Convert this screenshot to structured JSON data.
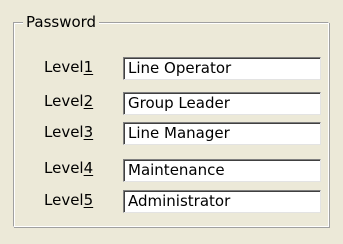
{
  "group": {
    "title": "Password"
  },
  "levels": [
    {
      "label": "Level",
      "number": "1",
      "value": "Line Operator"
    },
    {
      "label": "Level",
      "number": "2",
      "value": "Group Leader"
    },
    {
      "label": "Level",
      "number": "3",
      "value": "Line Manager"
    },
    {
      "label": "Level",
      "number": "4",
      "value": "Maintenance"
    },
    {
      "label": "Level",
      "number": "5",
      "value": "Administrator"
    }
  ]
}
